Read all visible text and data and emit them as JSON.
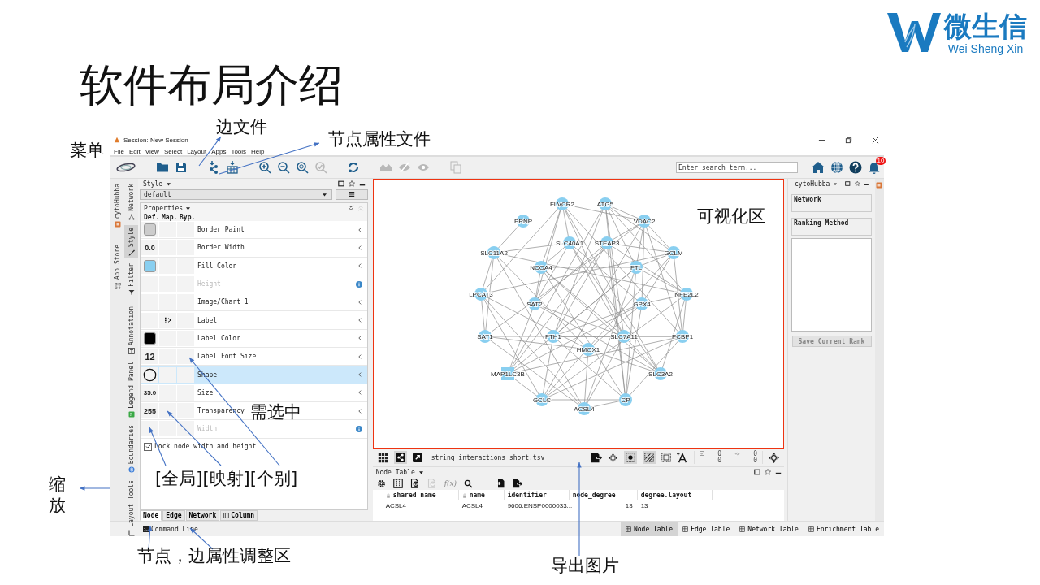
{
  "slide": {
    "title": "软件布局介绍"
  },
  "logo": {
    "brand": "微生信",
    "subtitle": "Wei Sheng Xin"
  },
  "window": {
    "title": "Session: New Session"
  },
  "menu": [
    "File",
    "Edit",
    "View",
    "Select",
    "Layout",
    "Apps",
    "Tools",
    "Help"
  ],
  "toolbar": {
    "search": {
      "placeholder": "Enter search term..."
    },
    "notifications": "10"
  },
  "side_tabs_outer": [
    {
      "label": "cytoHubba",
      "selected": false
    },
    {
      "label": "App Store",
      "selected": false
    }
  ],
  "side_tabs_inner": [
    {
      "label": "Network",
      "selected": false
    },
    {
      "label": "Style",
      "selected": true
    },
    {
      "label": "Filter",
      "selected": false
    },
    {
      "label": "Annotation",
      "selected": false
    },
    {
      "label": "Legend Panel",
      "selected": false
    },
    {
      "label": "Boundaries",
      "selected": false
    },
    {
      "label": "Layout Tools",
      "selected": false
    }
  ],
  "style_panel": {
    "title": "Style",
    "style": "default",
    "properties_label": "Properties",
    "columns": [
      "Def.",
      "Map.",
      "Byp."
    ],
    "properties": [
      {
        "name": "Border Paint",
        "default": {
          "kind": "swatch",
          "color": "#cccccc"
        },
        "mapped": false,
        "disabled": false,
        "selected": false
      },
      {
        "name": "Border Width",
        "default": {
          "kind": "value",
          "text": "0.0"
        },
        "mapped": false,
        "disabled": false,
        "selected": false
      },
      {
        "name": "Fill Color",
        "default": {
          "kind": "swatch",
          "color": "#89cff0"
        },
        "mapped": false,
        "disabled": false,
        "selected": false
      },
      {
        "name": "Height",
        "default": {
          "kind": "none"
        },
        "mapped": false,
        "disabled": true,
        "selected": false
      },
      {
        "name": "Image/Chart 1",
        "default": {
          "kind": "none"
        },
        "mapped": false,
        "disabled": false,
        "selected": false
      },
      {
        "name": "Label",
        "default": {
          "kind": "none"
        },
        "mapped": true,
        "disabled": false,
        "selected": false
      },
      {
        "name": "Label Color",
        "default": {
          "kind": "swatch",
          "color": "#000000"
        },
        "mapped": false,
        "disabled": false,
        "selected": false
      },
      {
        "name": "Label Font Size",
        "default": {
          "kind": "value",
          "text": "12"
        },
        "mapped": false,
        "disabled": false,
        "selected": false
      },
      {
        "name": "Shape",
        "default": {
          "kind": "shape"
        },
        "mapped": false,
        "disabled": false,
        "selected": true
      },
      {
        "name": "Size",
        "default": {
          "kind": "value",
          "text": "35.0"
        },
        "mapped": false,
        "disabled": false,
        "selected": false
      },
      {
        "name": "Transparency",
        "default": {
          "kind": "value",
          "text": "255"
        },
        "mapped": false,
        "disabled": false,
        "selected": false
      },
      {
        "name": "Width",
        "default": {
          "kind": "none"
        },
        "mapped": false,
        "disabled": true,
        "selected": false
      }
    ],
    "lock": {
      "label": "Lock node width and height",
      "checked": true
    },
    "bottom_tabs": [
      {
        "label": "Node",
        "selected": true
      },
      {
        "label": "Edge",
        "selected": false
      },
      {
        "label": "Network",
        "selected": false
      },
      {
        "label": "Column",
        "selected": false
      }
    ]
  },
  "network": {
    "nodes": [
      {
        "label": "FLVCR2",
        "kind": "circle"
      },
      {
        "label": "ATG5",
        "kind": "circle"
      },
      {
        "label": "PRNP",
        "kind": "circle"
      },
      {
        "label": "VDAC2",
        "kind": "circle"
      },
      {
        "label": "SLC40A1",
        "kind": "circle"
      },
      {
        "label": "STEAP3",
        "kind": "circle"
      },
      {
        "label": "SLC11A2",
        "kind": "circle"
      },
      {
        "label": "GCLM",
        "kind": "circle"
      },
      {
        "label": "NCOA4",
        "kind": "circle"
      },
      {
        "label": "FTL",
        "kind": "circle"
      },
      {
        "label": "LPCAT3",
        "kind": "circle"
      },
      {
        "label": "NFE2L2",
        "kind": "circle"
      },
      {
        "label": "SAT2",
        "kind": "circle"
      },
      {
        "label": "GPX4",
        "kind": "circle"
      },
      {
        "label": "SAT1",
        "kind": "circle"
      },
      {
        "label": "FTH1",
        "kind": "circle"
      },
      {
        "label": "SLC7A11",
        "kind": "circle"
      },
      {
        "label": "PCBP1",
        "kind": "circle"
      },
      {
        "label": "HMOX1",
        "kind": "circle"
      },
      {
        "label": "MAP1LC3B",
        "kind": "square"
      },
      {
        "label": "SLC3A2",
        "kind": "circle"
      },
      {
        "label": "GCLC",
        "kind": "circle"
      },
      {
        "label": "ACSL4",
        "kind": "circle"
      },
      {
        "label": "CP",
        "kind": "circle"
      }
    ],
    "file": "string_interactions_short.tsv",
    "counts": [
      "0",
      "0",
      "0",
      "0"
    ]
  },
  "node_table": {
    "title": "Node Table",
    "function_label": "f(x)",
    "columns": [
      {
        "label": "shared name",
        "locked": true
      },
      {
        "label": "name",
        "locked": true
      },
      {
        "label": "identifier",
        "locked": false
      },
      {
        "label": "node_degree",
        "locked": false
      },
      {
        "label": "degree.layout",
        "locked": false
      }
    ],
    "rows": [
      [
        "ACSL4",
        "ACSL4",
        "9606.ENSP0000033...",
        "13",
        "13"
      ]
    ]
  },
  "right_panel": {
    "title": "cytoHubba",
    "fields": [
      "Network",
      "Ranking Method"
    ],
    "save_button": {
      "label": "Save Current Rank",
      "disabled": true
    }
  },
  "status_bar": {
    "command": "Command Line",
    "tabs": [
      {
        "label": "Node Table",
        "selected": true
      },
      {
        "label": "Edge Table",
        "selected": false
      },
      {
        "label": "Network Table",
        "selected": false
      },
      {
        "label": "Enrichment Table",
        "selected": false
      }
    ]
  },
  "annotations": [
    {
      "text": "菜单"
    },
    {
      "text": "边文件"
    },
    {
      "text": "节点属性文件"
    },
    {
      "text": "可视化区"
    },
    {
      "text": "需选中"
    },
    {
      "text": "缩放"
    },
    {
      "text": "[全局][映射][个别]"
    },
    {
      "text": "节点，边属性调整区"
    },
    {
      "text": "导出图片"
    }
  ]
}
